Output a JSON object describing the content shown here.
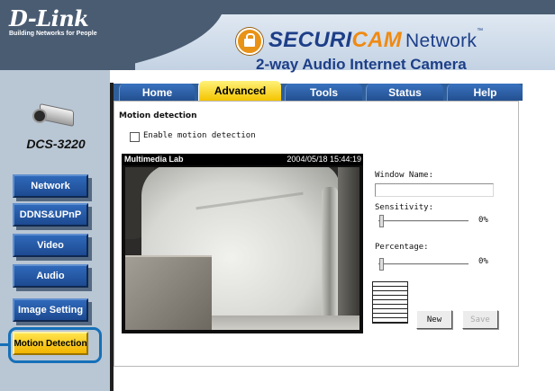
{
  "brand": {
    "logo": "D-Link",
    "tagline": "Building Networks for People",
    "product_a": "SECURI",
    "product_b": "CAM",
    "product_c": "Network",
    "product_tm": "™",
    "subtitle": "2-way Audio Internet Camera"
  },
  "device": {
    "model": "DCS-3220"
  },
  "sidebar": {
    "items": [
      {
        "label": "Network"
      },
      {
        "label": "DDNS&UPnP"
      },
      {
        "label": "Video"
      },
      {
        "label": "Audio"
      },
      {
        "label": "Image Setting"
      },
      {
        "label": "Motion Detection"
      }
    ],
    "selected": "Motion Detection"
  },
  "tabs": [
    {
      "label": "Home"
    },
    {
      "label": "Advanced"
    },
    {
      "label": "Tools"
    },
    {
      "label": "Status"
    },
    {
      "label": "Help"
    }
  ],
  "active_tab": "Advanced",
  "panel": {
    "title": "Motion detection",
    "enable_label": "Enable motion detection",
    "enabled": false,
    "viewer_name": "Multimedia Lab",
    "viewer_timestamp": "2004/05/18 15:44:19",
    "window_name_label": "Window Name:",
    "window_name_value": "",
    "sensitivity_label": "Sensitivity:",
    "sensitivity_value": "0%",
    "percentage_label": "Percentage:",
    "percentage_value": "0%",
    "new_label": "New",
    "save_label": "Save"
  },
  "colors": {
    "nav_blue": "#1d4a91",
    "selected_yellow": "#f2b400",
    "highlight_ring": "#1570b8",
    "brand_blue": "#1d3f88",
    "brand_orange": "#f08a12"
  }
}
